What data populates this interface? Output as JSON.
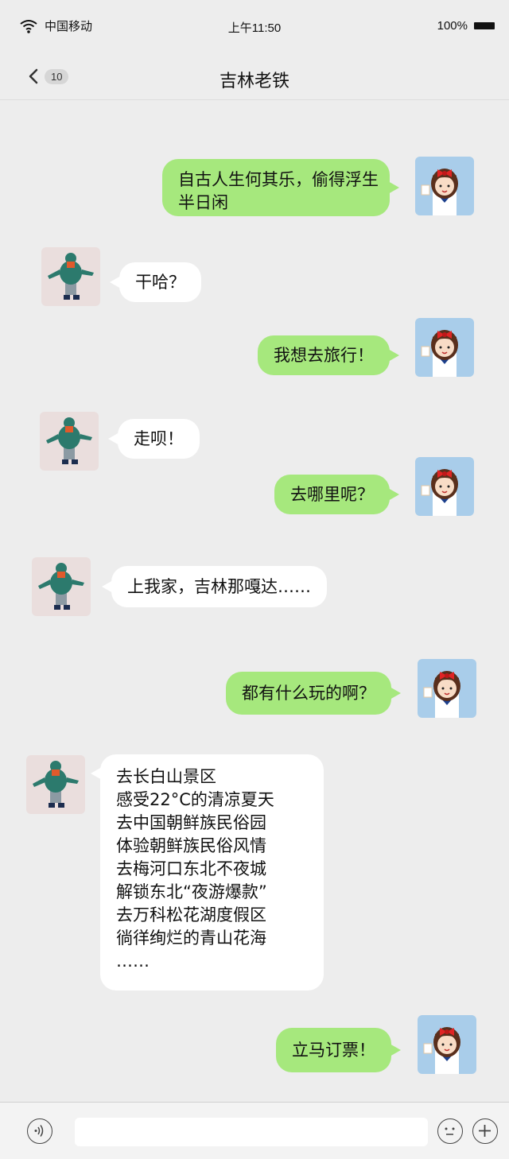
{
  "status": {
    "carrier": "中国移动",
    "time": "上午11:50",
    "battery": "100%"
  },
  "header": {
    "back_count": "10",
    "title": "吉林老铁"
  },
  "messages": [
    {
      "side": "right",
      "lines": [
        "自古人生何其乐，偷得浮生",
        "半日闲"
      ]
    },
    {
      "side": "left",
      "text": "干哈？"
    },
    {
      "side": "right",
      "text": "我想去旅行！"
    },
    {
      "side": "left",
      "text": "走呗！"
    },
    {
      "side": "right",
      "text": "去哪里呢？"
    },
    {
      "side": "left",
      "text": "上我家，吉林那嘎达……"
    },
    {
      "side": "right",
      "text": "都有什么玩的啊？"
    },
    {
      "side": "left",
      "lines": [
        "去长白山景区",
        "感受22°C的清凉夏天",
        "去中国朝鲜族民俗园",
        "体验朝鲜族民俗风情",
        "去梅河口东北不夜城",
        "解锁东北“夜游爆款”",
        "去万科松花湖度假区",
        "徜徉绚烂的青山花海",
        "……"
      ]
    },
    {
      "side": "right",
      "text": "立马订票！"
    }
  ],
  "input_bar": {
    "voice_icon": "voice-icon",
    "emoji_icon": "emoji-icon",
    "plus_icon": "plus-icon"
  },
  "colors": {
    "background": "#ededed",
    "my_bubble": "#a6e87d",
    "their_bubble": "#ffffff",
    "girl_avatar_bg": "#a9cdea",
    "boy_avatar_bg": "#eadedd"
  }
}
